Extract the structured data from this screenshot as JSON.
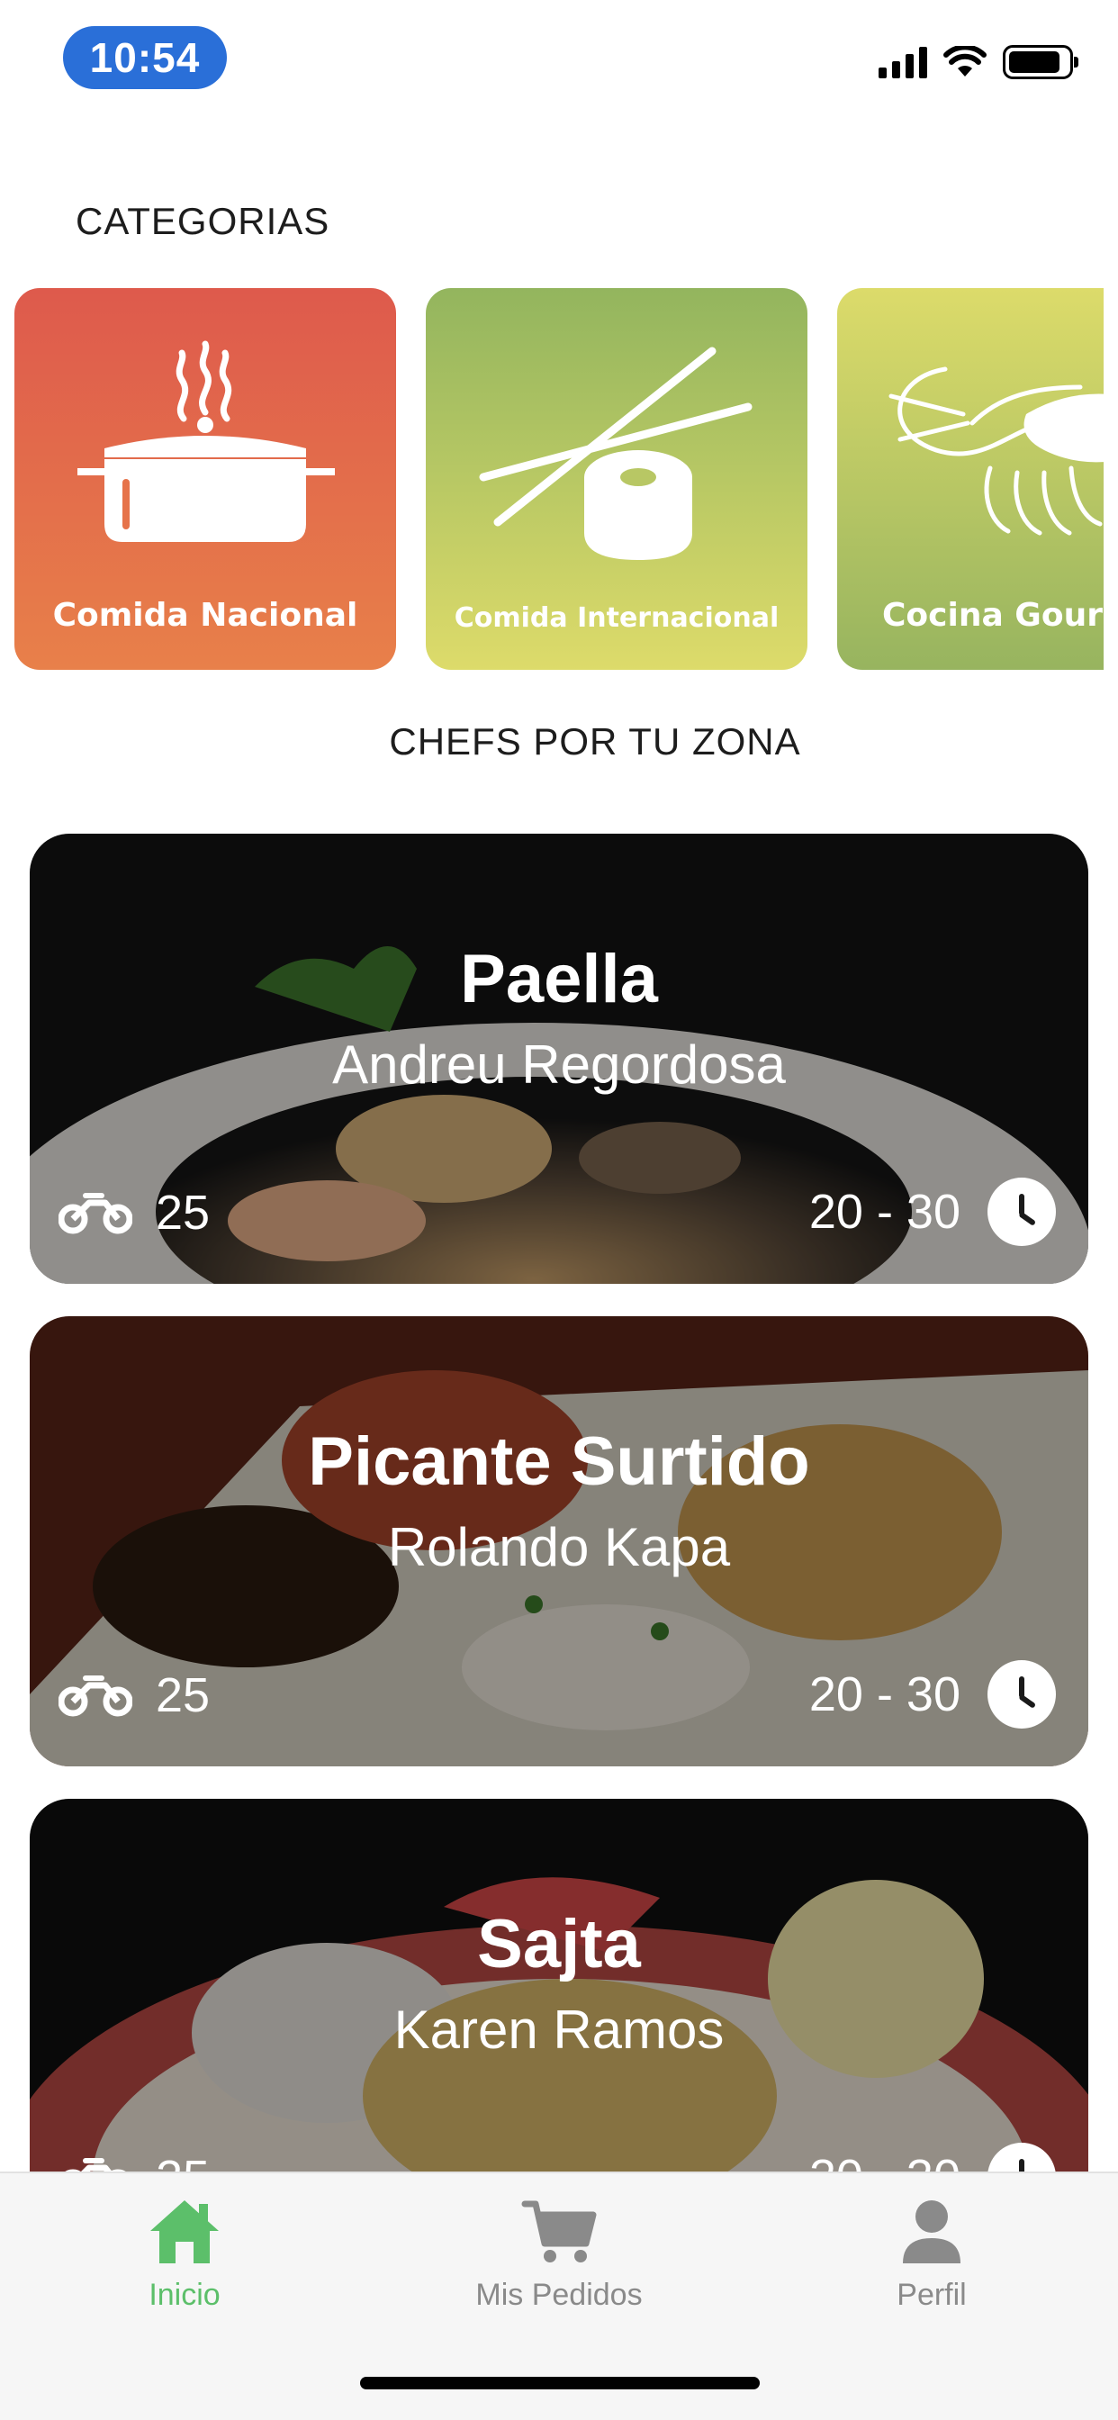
{
  "status_bar": {
    "time": "10:54",
    "icons": [
      "signal-icon",
      "wifi-icon",
      "battery-icon"
    ]
  },
  "categories_section": {
    "title": "CATEGORIAS",
    "items": [
      {
        "label": "Comida Nacional",
        "icon": "cooking-pot-icon"
      },
      {
        "label": "Comida Internacional",
        "icon": "sushi-chopsticks-icon"
      },
      {
        "label": "Cocina Gour",
        "icon": "shrimp-icon"
      }
    ]
  },
  "chefs_section": {
    "title": "CHEFS POR TU ZONA",
    "cards": [
      {
        "dish": "Paella",
        "chef": "Andreu Regordosa",
        "delivery": "25",
        "eta": "20 - 30"
      },
      {
        "dish": "Picante Surtido",
        "chef": "Rolando Kapa",
        "delivery": "25",
        "eta": "20 - 30"
      },
      {
        "dish": "Sajta",
        "chef": "Karen Ramos",
        "delivery": "25",
        "eta": "20 - 30"
      }
    ]
  },
  "tab_bar": {
    "tabs": [
      {
        "label": "Inicio",
        "icon": "home-icon",
        "active": true
      },
      {
        "label": "Mis Pedidos",
        "icon": "cart-icon",
        "active": false
      },
      {
        "label": "Perfil",
        "icon": "user-icon",
        "active": false
      }
    ]
  },
  "colors": {
    "accent": "#5cbf6a",
    "time_pill": "#2a6fd8",
    "inactive_tab": "#8a8a8a"
  }
}
